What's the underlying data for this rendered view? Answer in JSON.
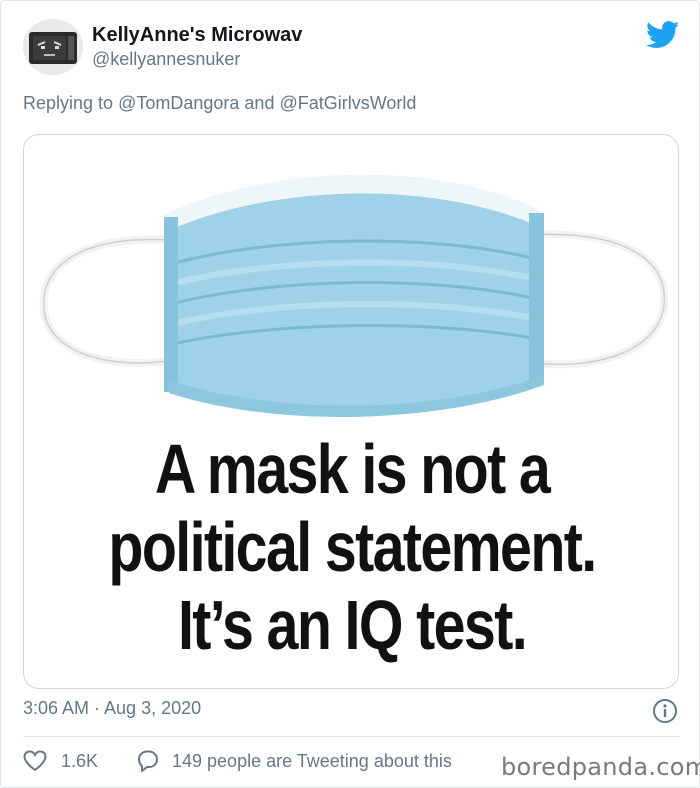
{
  "tweet": {
    "display_name": "KellyAnne's Microwav",
    "handle": "@kellyannesnuker",
    "reply_prefix": "Replying to",
    "reply_mentions": [
      "@TomDangora",
      "@FatGirlvsWorld"
    ],
    "reply_conjunction": "and",
    "media_text": [
      "A mask is not a",
      "political statement.",
      "It’s an IQ test."
    ],
    "timestamp": "3:06 AM · Aug 3, 2020",
    "like_count": "1.6K",
    "conversation": "149 people are Tweeting about this"
  },
  "watermark": "boredpanda.com",
  "icons": {
    "brand": "twitter-bird-icon",
    "info": "info-icon",
    "like": "heart-icon",
    "reply": "reply-bubble-icon"
  },
  "colors": {
    "brand_blue": "#1da1f2",
    "secondary_text": "#657786",
    "mask_blue": "#9fd2e8",
    "border": "#ccd6dd"
  }
}
